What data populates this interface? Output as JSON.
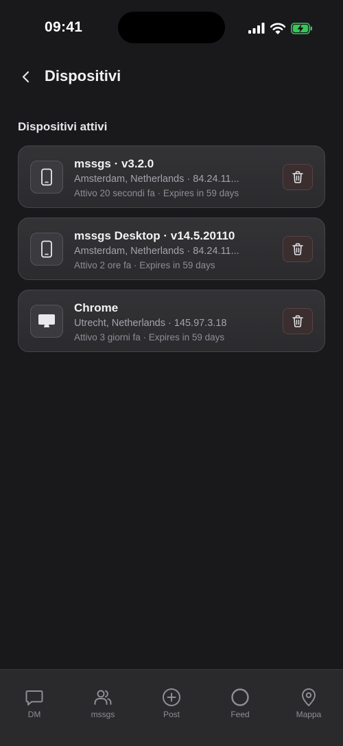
{
  "status_bar": {
    "time": "09:41",
    "icons": [
      "signal-icon",
      "wifi-icon",
      "battery-charging-icon"
    ],
    "battery_color": "#34c759"
  },
  "header": {
    "title": "Dispositivi",
    "back_icon": "chevron-left-icon"
  },
  "section": {
    "title": "Dispositivi attivi"
  },
  "devices": [
    {
      "icon": "smartphone-icon",
      "name": "mssgs · v3.2.0",
      "location": "Amsterdam, Netherlands · 84.24.11...",
      "activity": "Attivo 20 secondi fa · Expires in 59 days",
      "action_icon": "trash-icon"
    },
    {
      "icon": "smartphone-icon",
      "name": "mssgs Desktop · v14.5.20110",
      "location": "Amsterdam, Netherlands · 84.24.11...",
      "activity": "Attivo 2 ore fa · Expires in 59 days",
      "action_icon": "trash-icon"
    },
    {
      "icon": "desktop-monitor-icon",
      "name": "Chrome",
      "location": "Utrecht, Netherlands · 145.97.3.18",
      "activity": "Attivo 3 giorni fa · Expires in 59 days",
      "action_icon": "trash-icon"
    }
  ],
  "tab_bar": {
    "items": [
      {
        "label": "DM",
        "icon": "message-square-icon"
      },
      {
        "label": "mssgs",
        "icon": "users-icon"
      },
      {
        "label": "Post",
        "icon": "plus-circle-icon"
      },
      {
        "label": "Feed",
        "icon": "circle-icon"
      },
      {
        "label": "Mappa",
        "icon": "map-pin-icon"
      }
    ]
  },
  "colors": {
    "background": "#19191c",
    "card": "#2f2f32",
    "delete_button": "#3a2e2f"
  }
}
